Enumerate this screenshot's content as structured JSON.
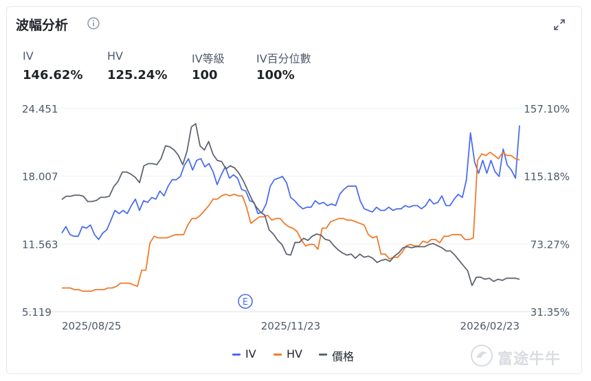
{
  "header": {
    "title": "波幅分析"
  },
  "stats": [
    {
      "label": "IV",
      "value": "146.62%"
    },
    {
      "label": "HV",
      "value": "125.24%"
    },
    {
      "label": "IV等級",
      "value": "100"
    },
    {
      "label": "IV百分位數",
      "value": "100%"
    }
  ],
  "watermark": "富途牛牛",
  "chart_data": {
    "type": "line",
    "x_ticks": [
      "2025/08/25",
      "2025/11/23",
      "2026/02/23"
    ],
    "left_axis": {
      "ticks": [
        "24.451",
        "18.007",
        "11.563",
        "5.119"
      ],
      "range": [
        5.119,
        24.451
      ]
    },
    "right_axis": {
      "ticks": [
        "157.10%",
        "115.18%",
        "73.27%",
        "31.35%"
      ],
      "range": [
        31.35,
        157.1
      ]
    },
    "event_marker": "E",
    "colors": {
      "IV": "#4a6cf0",
      "HV": "#f07a29",
      "價格": "#5e6470"
    },
    "series": [
      {
        "name": "IV",
        "axis": "right",
        "values": [
          80,
          84,
          79,
          78,
          78,
          84,
          83,
          85,
          79,
          76,
          80,
          82,
          88,
          94,
          92,
          94,
          92,
          97,
          101,
          94,
          100,
          99,
          102,
          101,
          106,
          103,
          109,
          113,
          113,
          115,
          122,
          126,
          119,
          125,
          126,
          121,
          123,
          118,
          110,
          116,
          121,
          114,
          116,
          114,
          107,
          106,
          100,
          99,
          92,
          93,
          98,
          109,
          113,
          114,
          115,
          111,
          102,
          100,
          97,
          95,
          96,
          96,
          100,
          98,
          99,
          97,
          98,
          97,
          104,
          107,
          109,
          109,
          109,
          100,
          95,
          94,
          93,
          96,
          94,
          94,
          96,
          94,
          95,
          95,
          97,
          96,
          97,
          97,
          95,
          97,
          101,
          98,
          99,
          103,
          97,
          97,
          101,
          104,
          102,
          113,
          142,
          124,
          117,
          125,
          117,
          125,
          118,
          115,
          132,
          122,
          119,
          114,
          146.62
        ]
      },
      {
        "name": "HV",
        "axis": "right",
        "values": [
          46,
          46,
          46,
          45,
          45,
          44,
          44,
          44,
          45,
          45,
          45,
          46,
          46,
          47,
          49,
          49,
          49,
          48,
          47,
          57,
          57,
          74,
          78,
          77,
          77,
          77,
          78,
          79,
          79,
          79,
          85,
          89,
          89,
          91,
          94,
          97,
          101,
          101,
          103,
          104,
          103,
          104,
          103,
          103,
          96,
          86,
          88,
          90,
          90,
          91,
          88,
          89,
          89,
          86,
          84,
          83,
          81,
          76,
          72,
          73,
          73,
          70,
          83,
          83,
          87,
          88,
          89,
          89,
          88,
          88,
          87,
          86,
          85,
          79,
          77,
          78,
          67,
          67,
          64,
          65,
          65,
          68,
          72,
          73,
          72,
          72,
          75,
          74,
          76,
          76,
          74,
          78,
          78,
          79,
          79,
          79,
          76,
          76,
          77,
          125,
          129,
          128,
          130,
          128,
          126,
          130,
          128,
          128,
          126,
          125.24
        ]
      },
      {
        "name": "價格",
        "axis": "left",
        "values": [
          15.8,
          16.1,
          16.1,
          16.2,
          16.2,
          16.1,
          15.6,
          15.6,
          15.7,
          16.0,
          16.0,
          16.1,
          17.0,
          17.5,
          18.4,
          18.4,
          18.2,
          17.9,
          17.4,
          19.0,
          19.2,
          19.2,
          19.1,
          19.7,
          20.9,
          20.8,
          20.5,
          20.0,
          19.1,
          20.4,
          22.7,
          23.0,
          20.9,
          20.5,
          21.3,
          20.1,
          19.5,
          19.4,
          18.7,
          19.0,
          18.8,
          18.3,
          17.6,
          16.7,
          15.8,
          15.1,
          14.6,
          14.3,
          12.9,
          12.5,
          11.9,
          11.5,
          10.6,
          10.5,
          11.7,
          11.7,
          12.1,
          11.9,
          12.3,
          12.5,
          12.4,
          12.0,
          11.9,
          11.4,
          11.0,
          10.7,
          10.5,
          10.6,
          10.2,
          10.6,
          10.3,
          10.4,
          10.2,
          9.8,
          10.0,
          10.1,
          9.9,
          10.4,
          10.7,
          11.2,
          11.3,
          11.2,
          11.3,
          11.3,
          11.3,
          11.5,
          11.6,
          11.4,
          11.2,
          10.9,
          10.9,
          10.5,
          10.0,
          9.5,
          9.0,
          7.6,
          8.4,
          8.4,
          8.2,
          8.3,
          8.0,
          8.2,
          8.1,
          8.3,
          8.3,
          8.3,
          8.2
        ]
      }
    ]
  }
}
